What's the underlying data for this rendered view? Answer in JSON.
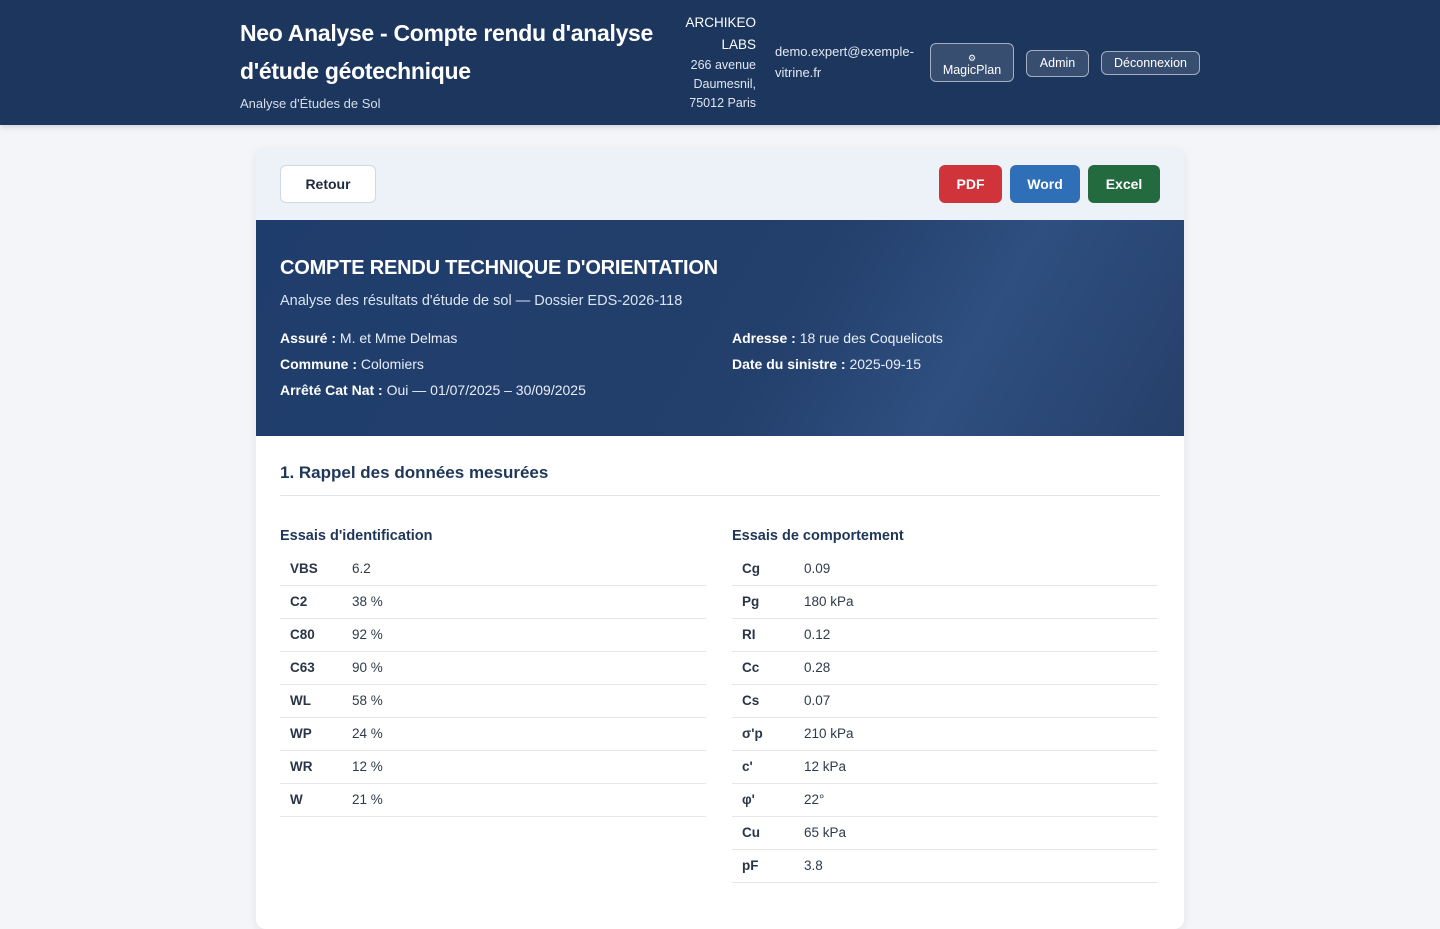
{
  "header": {
    "title": "Neo Analyse - Compte rendu d'analyse d'étude géotechnique",
    "subtitle": "Analyse d'Études de Sol",
    "company_name": "ARCHIKEO LABS",
    "company_address": "266 avenue Daumesnil, 75012 Paris",
    "user_email": "demo.expert@exemple-vitrine.fr",
    "magicplan_icon": "⚙",
    "magicplan_label": "MagicPlan",
    "admin_label": "Admin",
    "logout_label": "Déconnexion"
  },
  "toolbar": {
    "back_label": "Retour",
    "pdf_label": "PDF",
    "word_label": "Word",
    "excel_label": "Excel"
  },
  "banner": {
    "title": "COMPTE RENDU TECHNIQUE D'ORIENTATION",
    "subtitle": "Analyse des résultats d'étude de sol — Dossier EDS-2026-118",
    "assure_label": "Assuré :",
    "assure_value": "M. et Mme Delmas",
    "commune_label": "Commune :",
    "commune_value": "Colomiers",
    "arrete_label": "Arrêté Cat Nat :",
    "arrete_value": "Oui — 01/07/2025 – 30/09/2025",
    "adresse_label": "Adresse :",
    "adresse_value": "18 rue des Coquelicots",
    "date_label": "Date du sinistre :",
    "date_value": "2025-09-15"
  },
  "section1": {
    "title": "1. Rappel des données mesurées",
    "identification": {
      "title": "Essais d'identification",
      "rows": [
        {
          "k": "VBS",
          "v": "6.2"
        },
        {
          "k": "C2",
          "v": "38 %"
        },
        {
          "k": "C80",
          "v": "92 %"
        },
        {
          "k": "C63",
          "v": "90 %"
        },
        {
          "k": "WL",
          "v": "58 %"
        },
        {
          "k": "WP",
          "v": "24 %"
        },
        {
          "k": "WR",
          "v": "12 %"
        },
        {
          "k": "W",
          "v": "21 %"
        }
      ]
    },
    "comportement": {
      "title": "Essais de comportement",
      "rows": [
        {
          "k": "Cg",
          "v": "0.09"
        },
        {
          "k": "Pg",
          "v": "180 kPa"
        },
        {
          "k": "RI",
          "v": "0.12"
        },
        {
          "k": "Cc",
          "v": "0.28"
        },
        {
          "k": "Cs",
          "v": "0.07"
        },
        {
          "k": "σ'p",
          "v": "210 kPa"
        },
        {
          "k": "c'",
          "v": "12 kPa"
        },
        {
          "k": "φ'",
          "v": "22°"
        },
        {
          "k": "Cu",
          "v": "65 kPa"
        },
        {
          "k": "pF",
          "v": "3.8"
        }
      ]
    }
  }
}
